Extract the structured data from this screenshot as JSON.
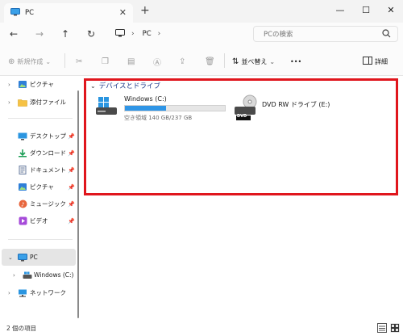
{
  "window": {
    "tab_title": "PC",
    "tab_close": "✕",
    "new_tab": "+",
    "minimize": "—",
    "maximize": "☐",
    "close": "✕"
  },
  "nav": {
    "back": "←",
    "forward": "→",
    "up": "↑",
    "refresh": "↻",
    "address_text": "PC",
    "address_chevron": "›",
    "search_placeholder": "PCの検索"
  },
  "toolbar": {
    "new_label": "新規作成",
    "sort_label": "並べ替え",
    "more": "•••",
    "details_label": "詳細"
  },
  "sidebar": {
    "items": [
      {
        "label": "ピクチャ",
        "pinned": false
      },
      {
        "label": "添付ファイル",
        "pinned": false
      },
      {
        "label": "デスクトップ",
        "pinned": true
      },
      {
        "label": "ダウンロード",
        "pinned": true
      },
      {
        "label": "ドキュメント",
        "pinned": true
      },
      {
        "label": "ピクチャ",
        "pinned": true
      },
      {
        "label": "ミュージック",
        "pinned": true
      },
      {
        "label": "ビデオ",
        "pinned": true
      },
      {
        "label": "PC",
        "selected": true
      },
      {
        "label": "Windows (C:)"
      },
      {
        "label": "ネットワーク"
      }
    ]
  },
  "content": {
    "group_title": "デバイスとドライブ",
    "drives": [
      {
        "name": "Windows (C:)",
        "usage_fraction": 0.41,
        "free_text": "空き領域 140 GB/237 GB"
      },
      {
        "name": "DVD RW ドライブ (E:)",
        "badge": "DVD"
      }
    ]
  },
  "status": {
    "text": "2 個の項目"
  },
  "colors": {
    "accent": "#2f95e6",
    "highlight": "#e0161d",
    "group_header": "#1e3a8a"
  }
}
